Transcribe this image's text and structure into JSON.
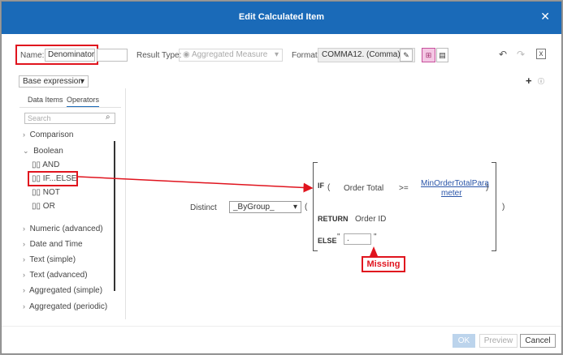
{
  "dialog": {
    "title": "Edit Calculated Item"
  },
  "toolbar": {
    "name_label": "Name:",
    "name_value": "Denominator",
    "result_type_label": "Result Type:",
    "result_type_value": "Aggregated Measure",
    "format_label": "Format:",
    "format_value": "COMMA12. (Comma)"
  },
  "expression_dropdown": "Base expression",
  "left_panel": {
    "tabs": [
      "Data Items",
      "Operators"
    ],
    "search_placeholder": "Search",
    "tree": {
      "comparison": "Comparison",
      "boolean": "Boolean",
      "boolean_children": [
        "AND",
        "IF...ELSE",
        "NOT",
        "OR"
      ],
      "rest": [
        "Numeric (advanced)",
        "Date and Time",
        "Text (simple)",
        "Text (advanced)",
        "Aggregated (simple)",
        "Aggregated (periodic)"
      ]
    }
  },
  "canvas": {
    "distinct_label": "Distinct",
    "group_value": "_ByGroup_",
    "if_kw": "IF",
    "order_total": "Order Total",
    "operator": ">=",
    "param_line1": "MinOrderTotalPara",
    "param_line2": "meter",
    "return_kw": "RETURN",
    "order_id": "Order ID",
    "else_kw": "ELSE",
    "else_value": ".",
    "missing_callout": "Missing"
  },
  "footer": {
    "ok": "OK",
    "preview": "Preview",
    "cancel": "Cancel"
  },
  "colors": {
    "titlebar": "#1a6ab8",
    "highlight": "#e0141e"
  }
}
